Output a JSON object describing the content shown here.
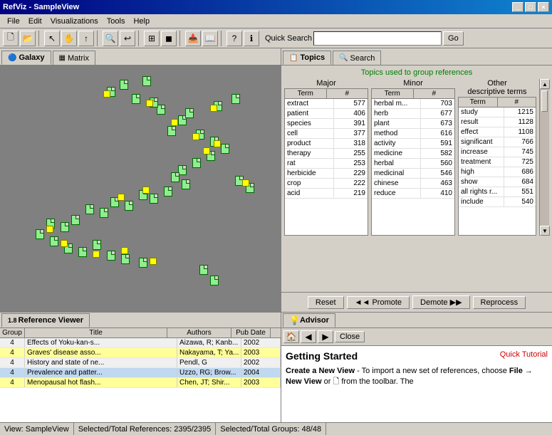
{
  "titleBar": {
    "title": "RefViz - SampleView",
    "buttons": [
      "_",
      "□",
      "×"
    ]
  },
  "menuBar": {
    "items": [
      "File",
      "Edit",
      "Visualizations",
      "Tools",
      "Help"
    ]
  },
  "toolbar": {
    "quickSearch": {
      "label": "Quick Search",
      "placeholder": "",
      "goBtn": "Go"
    }
  },
  "leftPanel": {
    "tabs": [
      {
        "label": "Galaxy",
        "icon": "🔵",
        "active": true
      },
      {
        "label": "Matrix",
        "icon": "▦",
        "active": false
      }
    ]
  },
  "rightPanel": {
    "tabs": [
      {
        "label": "Topics",
        "icon": "📋",
        "active": true
      },
      {
        "label": "Search",
        "icon": "🔍",
        "active": false
      }
    ],
    "topicsHeader": "Topics used to group references",
    "majorCol": {
      "header": "Major",
      "subheaders": [
        "Term",
        "#"
      ],
      "rows": [
        {
          "term": "extract",
          "num": "577"
        },
        {
          "term": "patient",
          "num": "406"
        },
        {
          "term": "species",
          "num": "391"
        },
        {
          "term": "cell",
          "num": "377"
        },
        {
          "term": "product",
          "num": "318"
        },
        {
          "term": "therapy",
          "num": "255"
        },
        {
          "term": "rat",
          "num": "253"
        },
        {
          "term": "herbicide",
          "num": "229"
        },
        {
          "term": "crop",
          "num": "222"
        },
        {
          "term": "acid",
          "num": "219"
        }
      ]
    },
    "minorCol": {
      "header": "Minor",
      "subheaders": [
        "Term",
        "#"
      ],
      "rows": [
        {
          "term": "herbal m...",
          "num": "703"
        },
        {
          "term": "herb",
          "num": "677"
        },
        {
          "term": "plant",
          "num": "673"
        },
        {
          "term": "method",
          "num": "616"
        },
        {
          "term": "activity",
          "num": "591"
        },
        {
          "term": "medicine",
          "num": "582"
        },
        {
          "term": "herbal",
          "num": "560"
        },
        {
          "term": "medicinal",
          "num": "546"
        },
        {
          "term": "chinese",
          "num": "463"
        },
        {
          "term": "reduce",
          "num": "410"
        }
      ]
    },
    "otherCol": {
      "header": "Other",
      "headerLine2": "descriptive terms",
      "subheaders": [
        "Term",
        "#"
      ],
      "rows": [
        {
          "term": "study",
          "num": "1215"
        },
        {
          "term": "result",
          "num": "1128"
        },
        {
          "term": "effect",
          "num": "1108"
        },
        {
          "term": "significant",
          "num": "766"
        },
        {
          "term": "increase",
          "num": "745"
        },
        {
          "term": "treatment",
          "num": "725"
        },
        {
          "term": "high",
          "num": "686"
        },
        {
          "term": "show",
          "num": "684"
        },
        {
          "term": "all rights r...",
          "num": "551"
        },
        {
          "term": "include",
          "num": "540"
        }
      ]
    },
    "actions": {
      "reset": "Reset",
      "promote": "◄◄ Promote",
      "demote": "Demote ▶▶",
      "reprocess": "Reprocess"
    }
  },
  "refViewer": {
    "tabLabel": "Reference Viewer",
    "tabVersion": "1.8",
    "columns": [
      "Group",
      "Title",
      "Authors",
      "Pub Date"
    ],
    "rows": [
      {
        "group": "4",
        "title": "Effects of Yoku-kan-s...",
        "authors": "Aizawa, R; Kanb...",
        "date": "2002"
      },
      {
        "group": "4",
        "title": "Graves' disease asso...",
        "authors": "Nakayama, T; Ya...",
        "date": "2003"
      },
      {
        "group": "4",
        "title": "History and state of ne...",
        "authors": "Pendl, G",
        "date": "2002"
      },
      {
        "group": "4",
        "title": "Prevalence and patter...",
        "authors": "Uzzo, RG; Brow...",
        "date": "2004"
      },
      {
        "group": "4",
        "title": "Menopausal hot flash...",
        "authors": "Chen, JT; Shir...",
        "date": "2003"
      }
    ]
  },
  "advisor": {
    "tabLabel": "Advisor",
    "lightBulb": "💡",
    "title": "Getting Started",
    "quickTutorialLink": "Quick Tutorial",
    "content": "Create a New View - To import a new set of references, choose File → New View or",
    "contentContinued": "from the toolbar. The"
  },
  "statusBar": {
    "view": "View: SampleView",
    "selected": "Selected/Total References: 2395/2395",
    "groups": "Selected/Total Groups: 48/48"
  }
}
